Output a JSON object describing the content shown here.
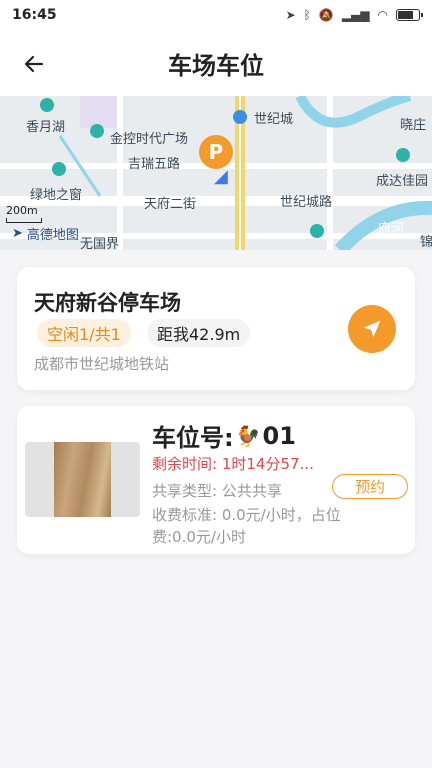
{
  "status_bar": {
    "time": "16:45",
    "icons": [
      "location-icon",
      "bluetooth-icon",
      "mute-icon",
      "signal-icon",
      "wifi-icon",
      "battery-icon"
    ]
  },
  "header": {
    "title": "车场车位",
    "back_icon": "arrow-left-icon"
  },
  "map": {
    "labels": [
      "香月湖",
      "金控时代广场",
      "世纪城",
      "晓庄",
      "吉瑞五路",
      "成达佳园",
      "绿地之窗",
      "天府二街",
      "世纪城路",
      "府河",
      "锦",
      "无国界"
    ],
    "scale": "200m",
    "logo": "高德地图",
    "marker_label": "P"
  },
  "parking_lot": {
    "name": "天府新谷停车场",
    "vacancy": "空闲1/共1",
    "distance": "距我42.9m",
    "address": "成都市世纪城地铁站"
  },
  "parking_space": {
    "number_prefix": "车位号:",
    "number_emoji": "🐓",
    "number": "01",
    "remaining_time": "剩余时间: 1时14分57...",
    "share_type": "共享类型: 公共共享",
    "fee": "收费标准: 0.0元/小时，占位费:0.0元/小时",
    "reserve_label": "预约"
  },
  "colors": {
    "accent": "#f39a2b",
    "warning": "#e0464e",
    "muted": "#999999"
  }
}
